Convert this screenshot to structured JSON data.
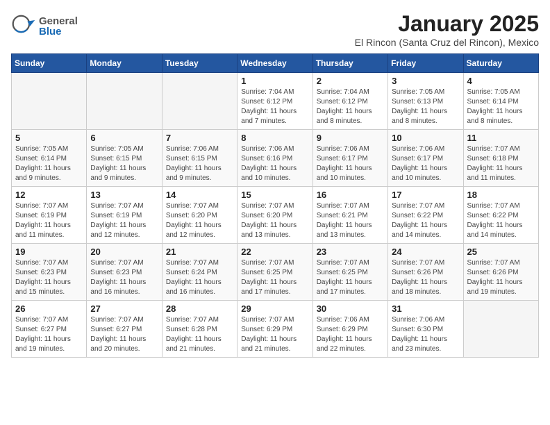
{
  "logo": {
    "general": "General",
    "blue": "Blue"
  },
  "title": "January 2025",
  "subtitle": "El Rincon (Santa Cruz del Rincon), Mexico",
  "days_of_week": [
    "Sunday",
    "Monday",
    "Tuesday",
    "Wednesday",
    "Thursday",
    "Friday",
    "Saturday"
  ],
  "weeks": [
    [
      {
        "day": "",
        "info": ""
      },
      {
        "day": "",
        "info": ""
      },
      {
        "day": "",
        "info": ""
      },
      {
        "day": "1",
        "info": "Sunrise: 7:04 AM\nSunset: 6:12 PM\nDaylight: 11 hours and 7 minutes."
      },
      {
        "day": "2",
        "info": "Sunrise: 7:04 AM\nSunset: 6:12 PM\nDaylight: 11 hours and 8 minutes."
      },
      {
        "day": "3",
        "info": "Sunrise: 7:05 AM\nSunset: 6:13 PM\nDaylight: 11 hours and 8 minutes."
      },
      {
        "day": "4",
        "info": "Sunrise: 7:05 AM\nSunset: 6:14 PM\nDaylight: 11 hours and 8 minutes."
      }
    ],
    [
      {
        "day": "5",
        "info": "Sunrise: 7:05 AM\nSunset: 6:14 PM\nDaylight: 11 hours and 9 minutes."
      },
      {
        "day": "6",
        "info": "Sunrise: 7:05 AM\nSunset: 6:15 PM\nDaylight: 11 hours and 9 minutes."
      },
      {
        "day": "7",
        "info": "Sunrise: 7:06 AM\nSunset: 6:15 PM\nDaylight: 11 hours and 9 minutes."
      },
      {
        "day": "8",
        "info": "Sunrise: 7:06 AM\nSunset: 6:16 PM\nDaylight: 11 hours and 10 minutes."
      },
      {
        "day": "9",
        "info": "Sunrise: 7:06 AM\nSunset: 6:17 PM\nDaylight: 11 hours and 10 minutes."
      },
      {
        "day": "10",
        "info": "Sunrise: 7:06 AM\nSunset: 6:17 PM\nDaylight: 11 hours and 10 minutes."
      },
      {
        "day": "11",
        "info": "Sunrise: 7:07 AM\nSunset: 6:18 PM\nDaylight: 11 hours and 11 minutes."
      }
    ],
    [
      {
        "day": "12",
        "info": "Sunrise: 7:07 AM\nSunset: 6:19 PM\nDaylight: 11 hours and 11 minutes."
      },
      {
        "day": "13",
        "info": "Sunrise: 7:07 AM\nSunset: 6:19 PM\nDaylight: 11 hours and 12 minutes."
      },
      {
        "day": "14",
        "info": "Sunrise: 7:07 AM\nSunset: 6:20 PM\nDaylight: 11 hours and 12 minutes."
      },
      {
        "day": "15",
        "info": "Sunrise: 7:07 AM\nSunset: 6:20 PM\nDaylight: 11 hours and 13 minutes."
      },
      {
        "day": "16",
        "info": "Sunrise: 7:07 AM\nSunset: 6:21 PM\nDaylight: 11 hours and 13 minutes."
      },
      {
        "day": "17",
        "info": "Sunrise: 7:07 AM\nSunset: 6:22 PM\nDaylight: 11 hours and 14 minutes."
      },
      {
        "day": "18",
        "info": "Sunrise: 7:07 AM\nSunset: 6:22 PM\nDaylight: 11 hours and 14 minutes."
      }
    ],
    [
      {
        "day": "19",
        "info": "Sunrise: 7:07 AM\nSunset: 6:23 PM\nDaylight: 11 hours and 15 minutes."
      },
      {
        "day": "20",
        "info": "Sunrise: 7:07 AM\nSunset: 6:23 PM\nDaylight: 11 hours and 16 minutes."
      },
      {
        "day": "21",
        "info": "Sunrise: 7:07 AM\nSunset: 6:24 PM\nDaylight: 11 hours and 16 minutes."
      },
      {
        "day": "22",
        "info": "Sunrise: 7:07 AM\nSunset: 6:25 PM\nDaylight: 11 hours and 17 minutes."
      },
      {
        "day": "23",
        "info": "Sunrise: 7:07 AM\nSunset: 6:25 PM\nDaylight: 11 hours and 17 minutes."
      },
      {
        "day": "24",
        "info": "Sunrise: 7:07 AM\nSunset: 6:26 PM\nDaylight: 11 hours and 18 minutes."
      },
      {
        "day": "25",
        "info": "Sunrise: 7:07 AM\nSunset: 6:26 PM\nDaylight: 11 hours and 19 minutes."
      }
    ],
    [
      {
        "day": "26",
        "info": "Sunrise: 7:07 AM\nSunset: 6:27 PM\nDaylight: 11 hours and 19 minutes."
      },
      {
        "day": "27",
        "info": "Sunrise: 7:07 AM\nSunset: 6:27 PM\nDaylight: 11 hours and 20 minutes."
      },
      {
        "day": "28",
        "info": "Sunrise: 7:07 AM\nSunset: 6:28 PM\nDaylight: 11 hours and 21 minutes."
      },
      {
        "day": "29",
        "info": "Sunrise: 7:07 AM\nSunset: 6:29 PM\nDaylight: 11 hours and 21 minutes."
      },
      {
        "day": "30",
        "info": "Sunrise: 7:06 AM\nSunset: 6:29 PM\nDaylight: 11 hours and 22 minutes."
      },
      {
        "day": "31",
        "info": "Sunrise: 7:06 AM\nSunset: 6:30 PM\nDaylight: 11 hours and 23 minutes."
      },
      {
        "day": "",
        "info": ""
      }
    ]
  ]
}
